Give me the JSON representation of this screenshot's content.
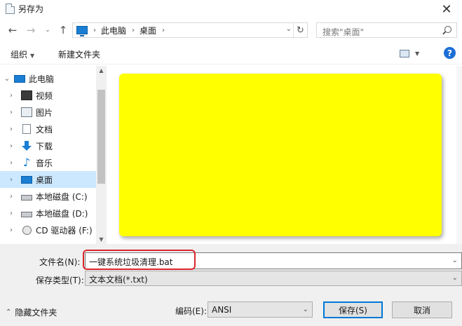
{
  "window": {
    "title": "另存为",
    "close_glyph": "✕"
  },
  "nav": {
    "back_glyph": "←",
    "forward_glyph": "→",
    "recent_glyph": "⌄",
    "up_glyph": "↑",
    "breadcrumb": [
      "此电脑",
      "桌面"
    ],
    "breadcrumb_sep": "›",
    "dropdown_glyph": "⌄",
    "refresh_glyph": "↻",
    "search_placeholder": "搜索\"桌面\""
  },
  "toolbar": {
    "organize_label": "组织",
    "organize_dd": "▼",
    "new_folder_label": "新建文件夹",
    "view_dd": "▼",
    "help_label": "?"
  },
  "sidebar": {
    "items": [
      {
        "label": "此电脑",
        "icon": "pc-icon",
        "chevron": "⌄"
      },
      {
        "label": "视频",
        "icon": "video-icon",
        "chevron": "›"
      },
      {
        "label": "图片",
        "icon": "picture-icon",
        "chevron": "›"
      },
      {
        "label": "文档",
        "icon": "document-icon",
        "chevron": "›"
      },
      {
        "label": "下载",
        "icon": "download-icon",
        "chevron": "›"
      },
      {
        "label": "音乐",
        "icon": "music-icon",
        "chevron": "›"
      },
      {
        "label": "桌面",
        "icon": "desktop-icon",
        "chevron": "›",
        "selected": true
      },
      {
        "label": "本地磁盘 (C:)",
        "icon": "disk-icon",
        "chevron": "›"
      },
      {
        "label": "本地磁盘 (D:)",
        "icon": "disk-icon",
        "chevron": "›"
      },
      {
        "label": "CD 驱动器 (F:)",
        "icon": "cd-icon",
        "chevron": "›"
      }
    ],
    "music_glyph": "♪",
    "scroll_up": "▲",
    "scroll_down": "▼"
  },
  "form": {
    "filename_label": "文件名(N):",
    "filename_value": "一键系统垃圾清理.bat",
    "filename_dd": "⌄",
    "filetype_label": "保存类型(T):",
    "filetype_value": "文本文档(*.txt)",
    "filetype_dd": "⌄",
    "hide_folders_glyph": "⌃",
    "hide_folders_label": "隐藏文件夹",
    "encoding_label": "编码(E):",
    "encoding_value": "ANSI",
    "encoding_dd": "⌄",
    "save_label": "保存(S)",
    "cancel_label": "取消"
  },
  "colors": {
    "accent": "#0078d7",
    "highlight": "#d9262c",
    "preview_fill": "#ffff00",
    "selected_row": "#cce8ff"
  }
}
